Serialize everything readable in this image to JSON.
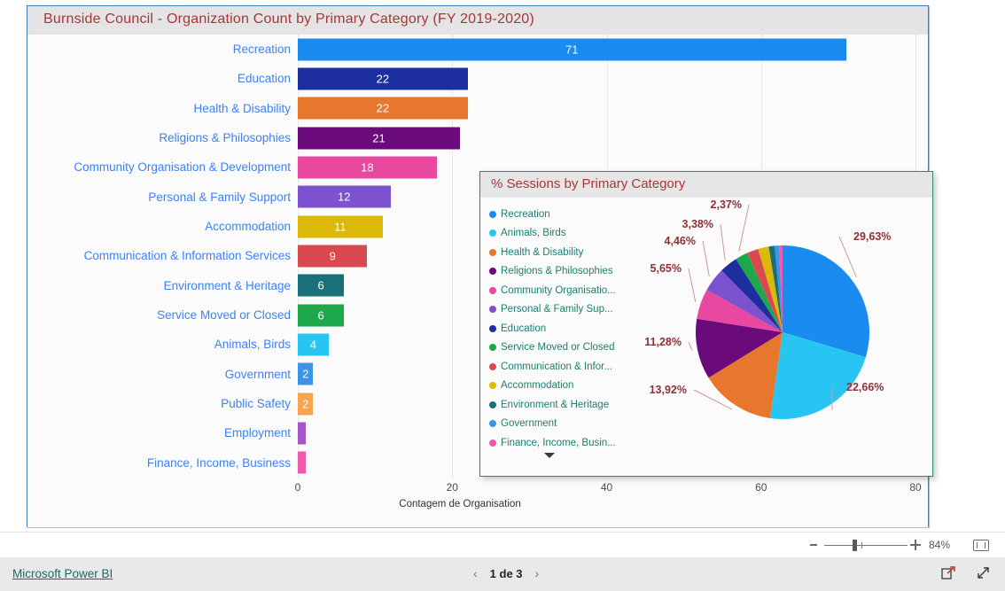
{
  "report": {
    "title": "Burnside Council - Organization Count by Primary Category (FY 2019-2020)"
  },
  "pie_panel": {
    "title": "% Sessions by Primary Category",
    "more_icon": "chevron-down-icon"
  },
  "zoom_bar": {
    "minus_label": "-",
    "plus_label": "+",
    "percent": "84%",
    "fit_icon": "fit-to-width-icon"
  },
  "footer": {
    "brand_link": "Microsoft Power BI",
    "prev_label": "‹",
    "page_text": "1 de 3",
    "next_label": "›",
    "share_icon": "share-icon",
    "fullscreen_icon": "fullscreen-icon"
  },
  "chart_data": [
    {
      "type": "bar",
      "title": "Burnside Council - Organization Count by Primary Category (FY 2019-2020)",
      "orientation": "horizontal",
      "xlabel": "Contagem de Organisation",
      "ylabel": "",
      "xlim": [
        0,
        80
      ],
      "xticks": [
        "0",
        "20",
        "40",
        "60",
        "80"
      ],
      "grid": true,
      "categories": [
        "Recreation",
        "Education",
        "Health & Disability",
        "Religions & Philosophies",
        "Community Organisation & Development",
        "Personal & Family Support",
        "Accommodation",
        "Communication & Information Services",
        "Environment & Heritage",
        "Service Moved or Closed",
        "Animals, Birds",
        "Government",
        "Public Safety",
        "Employment",
        "Finance, Income, Business"
      ],
      "values": [
        71,
        22,
        22,
        21,
        18,
        12,
        11,
        9,
        6,
        6,
        4,
        2,
        2,
        1,
        1
      ],
      "value_labels": [
        "71",
        "22",
        "22",
        "21",
        "18",
        "12",
        "11",
        "9",
        "6",
        "6",
        "4",
        "2",
        "2",
        "",
        ""
      ],
      "colors": [
        "#1a8cf0",
        "#1d2f9e",
        "#e8772e",
        "#6b0a7a",
        "#e8489f",
        "#7d52ce",
        "#dcb808",
        "#d9494f",
        "#1a7078",
        "#1da84c",
        "#29c5f2",
        "#3b93ea",
        "#f7a44e",
        "#a855c8",
        "#ef5aaa"
      ]
    },
    {
      "type": "pie",
      "title": "% Sessions by Primary Category",
      "legend_position": "left",
      "labels": [
        "Recreation",
        "Animals, Birds",
        "Health & Disability",
        "Religions & Philosophies",
        "Community Organisatio...",
        "Personal & Family Sup...",
        "Education",
        "Service Moved or Closed",
        "Communication & Infor...",
        "Accommodation",
        "Environment & Heritage",
        "Government",
        "Finance, Income, Busin..."
      ],
      "values": [
        29.63,
        22.66,
        13.92,
        11.28,
        5.65,
        4.46,
        3.38,
        2.37,
        2.1,
        2.0,
        1.1,
        0.8,
        0.65
      ],
      "visible_labels": [
        "29,63%",
        "22,66%",
        "13,92%",
        "11,28%",
        "5,65%",
        "4,46%",
        "3,38%",
        "2,37%"
      ],
      "colors": [
        "#1a8cf0",
        "#29c5f2",
        "#e8772e",
        "#6b0a7a",
        "#e8489f",
        "#7d52ce",
        "#1d2f9e",
        "#1da84c",
        "#d9494f",
        "#dcb808",
        "#1a7078",
        "#3b93ea",
        "#ef5aaa"
      ]
    }
  ]
}
